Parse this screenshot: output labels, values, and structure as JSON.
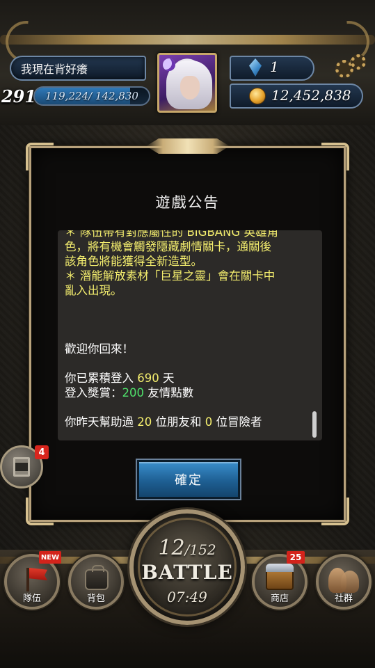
{
  "player": {
    "name": "我現在背好癢",
    "level": "291",
    "exp_text": "119,224/ 142,830",
    "exp_fraction": 0.835
  },
  "currency": {
    "gems": "1",
    "gold": "12,452,838"
  },
  "dialog": {
    "title": "遊戲公告",
    "lines": [
      {
        "text": "＊ 隊伍帶有對應屬性的 BIGBANG 英雄角",
        "color": "yellow"
      },
      {
        "text": "色，將有機會觸發隱藏劇情關卡，通關後",
        "color": "yellow"
      },
      {
        "text": "該角色將能獲得全新造型。",
        "color": "yellow"
      },
      {
        "text": "＊ 潛能解放素材「巨星之靈」會在關卡中",
        "color": "yellow"
      },
      {
        "text": "亂入出現。",
        "color": "yellow"
      }
    ],
    "welcome": "歡迎你回來！",
    "login_prefix": "你已累積登入 ",
    "login_days": "690",
    "login_suffix": " 天",
    "reward_prefix": "登入獎賞：",
    "reward_points": "200",
    "reward_suffix": " 友情點數",
    "help_prefix": "你昨天幫助過 ",
    "help_friends": "20",
    "help_mid": " 位朋友和 ",
    "help_adventurers": "0",
    "help_suffix": " 位冒險者",
    "confirm_label": "確定"
  },
  "side": {
    "badge": "4"
  },
  "battle": {
    "stamina_current": "12",
    "stamina_max": "/152",
    "label": "BATTLE",
    "timer": "07:49"
  },
  "nav": {
    "team_label": "隊伍",
    "team_badge": "NEW",
    "bag_label": "背包",
    "shop_label": "商店",
    "shop_badge": "25",
    "social_label": "社群"
  },
  "colors": {
    "highlight_yellow": "#f4ee6e",
    "highlight_green": "#4fe06b",
    "button_blue": "#1e5f93",
    "badge_red": "#d3231b"
  }
}
